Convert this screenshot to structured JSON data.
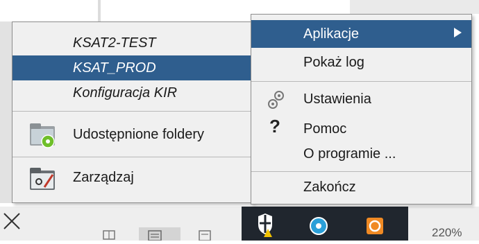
{
  "context_menu_left": {
    "items": [
      {
        "label": "KSAT2-TEST",
        "italic": true,
        "selected": false
      },
      {
        "label": "KSAT_PROD",
        "italic": true,
        "selected": true
      },
      {
        "label": "Konfiguracja KIR",
        "italic": true,
        "selected": false
      },
      {
        "label": "Udostępnione foldery",
        "icon": "shared-folder-icon"
      },
      {
        "label": "Zarządzaj",
        "icon": "manage-folder-icon"
      }
    ]
  },
  "context_menu_right": {
    "items": [
      {
        "label": "Aplikacje",
        "selected": true,
        "has_submenu": true
      },
      {
        "label": "Pokaż log"
      },
      {
        "label": "Ustawienia",
        "icon": "gears-icon"
      },
      {
        "label": "Pomoc",
        "icon": "question-mark-icon"
      },
      {
        "label": "O programie ..."
      },
      {
        "label": "Zakończ"
      }
    ]
  },
  "status_bar": {
    "zoom": "220%"
  },
  "colors": {
    "selection": "#2f5e8e",
    "menu_bg": "#f0f0f0",
    "taskbar": "#20262e"
  }
}
